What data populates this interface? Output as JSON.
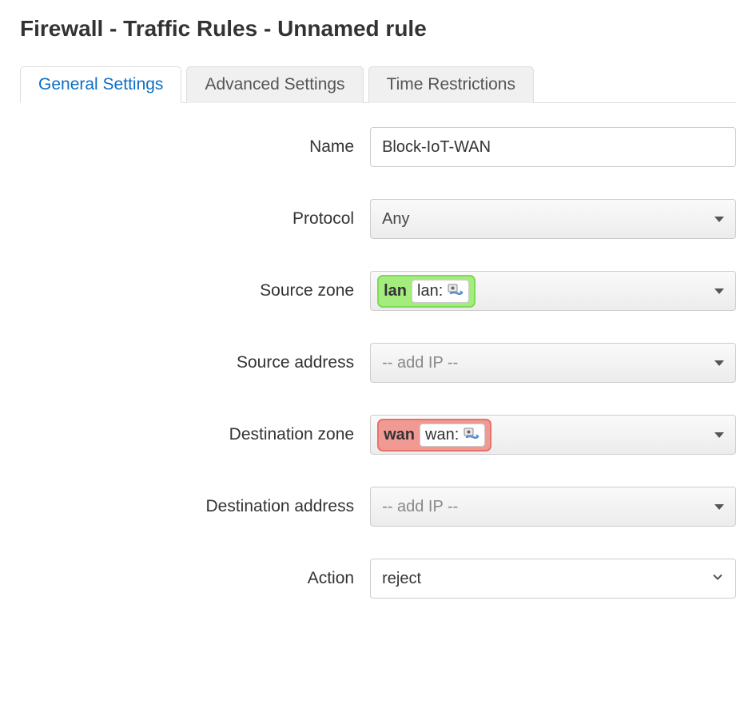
{
  "title": "Firewall - Traffic Rules - Unnamed rule",
  "tabs": {
    "t0": "General Settings",
    "t1": "Advanced Settings",
    "t2": "Time Restrictions"
  },
  "labels": {
    "name": "Name",
    "protocol": "Protocol",
    "srczone": "Source zone",
    "srcaddr": "Source address",
    "destzone": "Destination zone",
    "destaddr": "Destination address",
    "action": "Action"
  },
  "fields": {
    "name": "Block-IoT-WAN",
    "protocol": "Any",
    "srczone": {
      "zone": "lan",
      "iface": "lan:"
    },
    "srcaddr_placeholder": "-- add IP --",
    "destzone": {
      "zone": "wan",
      "iface": "wan:"
    },
    "destaddr_placeholder": "-- add IP --",
    "action": "reject"
  }
}
